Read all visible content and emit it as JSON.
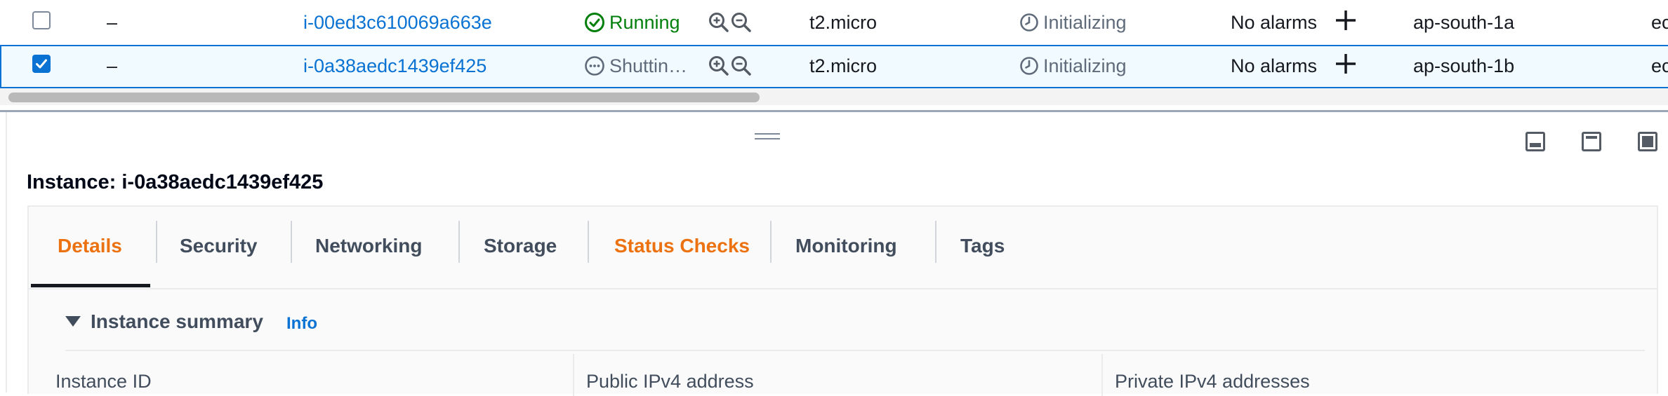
{
  "table": {
    "rows": [
      {
        "checked": false,
        "name": "–",
        "instance_id": "i-00ed3c610069a663e",
        "state": "Running",
        "instance_type": "t2.micro",
        "status_check": "Initializing",
        "alarm_status": "No alarms",
        "availability_zone": "ap-south-1a",
        "truncated_next_col": "ec"
      },
      {
        "checked": true,
        "name": "–",
        "instance_id": "i-0a38aedc1439ef425",
        "state": "Shuttin…",
        "instance_type": "t2.micro",
        "status_check": "Initializing",
        "alarm_status": "No alarms",
        "availability_zone": "ap-south-1b",
        "truncated_next_col": "ec"
      }
    ]
  },
  "icons": {
    "running_state": "check-circle-icon",
    "shutting_state": "ellipsis-circle-icon",
    "zoom_in": "zoom-in-icon",
    "zoom_out": "zoom-out-icon",
    "status_pending": "clock-icon",
    "add_alarm": "plus-icon"
  },
  "detail_panel": {
    "title": "Instance: i-0a38aedc1439ef425",
    "tabs": [
      {
        "label": "Details",
        "active": true
      },
      {
        "label": "Security"
      },
      {
        "label": "Networking"
      },
      {
        "label": "Storage"
      },
      {
        "label": "Status Checks",
        "highlight": true
      },
      {
        "label": "Monitoring"
      },
      {
        "label": "Tags"
      }
    ],
    "summary": {
      "heading": "Instance summary",
      "info_link": "Info",
      "fields": [
        "Instance ID",
        "Public IPv4 address",
        "Private IPv4 addresses"
      ]
    }
  },
  "colors": {
    "link": "#0972d3",
    "running": "#037f0c",
    "active_tab": "#ec7211",
    "selected_row_bg": "#f1faff"
  }
}
